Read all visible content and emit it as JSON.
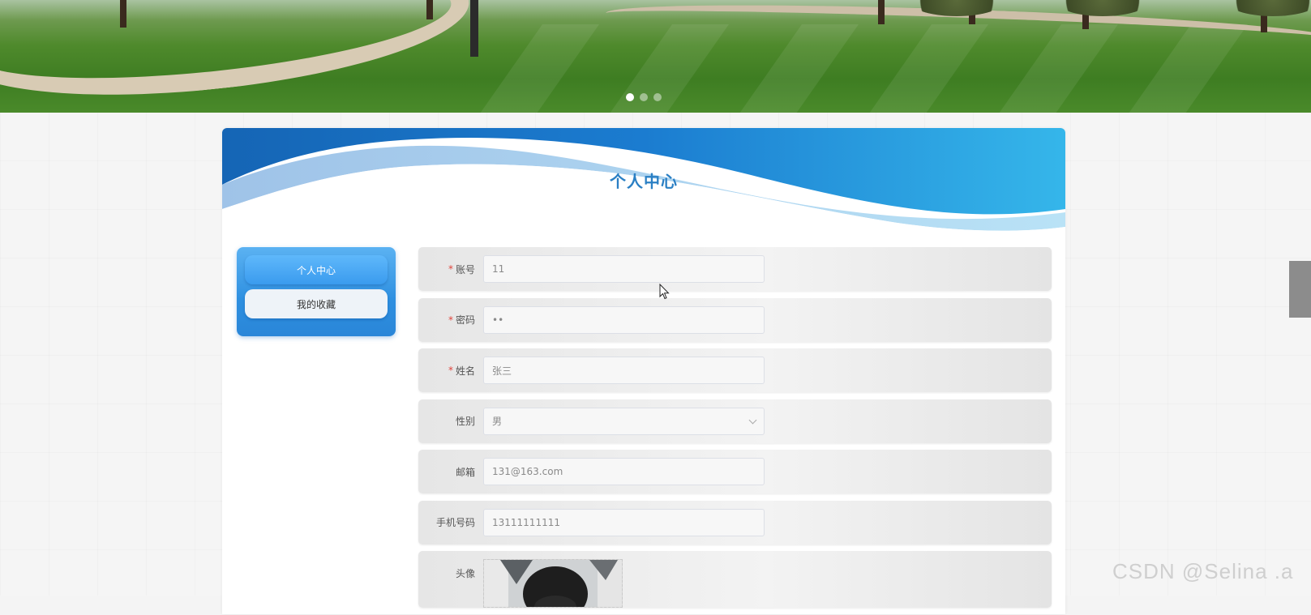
{
  "banner": {
    "slides": [
      {
        "active": true
      },
      {
        "active": false
      },
      {
        "active": false
      }
    ]
  },
  "page": {
    "title": "个人中心"
  },
  "side_menu": {
    "items": [
      {
        "label": "个人中心",
        "active": true
      },
      {
        "label": "我的收藏",
        "active": false
      }
    ]
  },
  "form": {
    "account": {
      "label": "账号",
      "required": true,
      "value": "11"
    },
    "password": {
      "label": "密码",
      "required": true,
      "value": "••"
    },
    "name": {
      "label": "姓名",
      "required": true,
      "value": "张三"
    },
    "gender": {
      "label": "性别",
      "required": false,
      "value": "男"
    },
    "email": {
      "label": "邮箱",
      "required": false,
      "value": "131@163.com"
    },
    "phone": {
      "label": "手机号码",
      "required": false,
      "value": "13111111111"
    },
    "avatar": {
      "label": "头像",
      "required": false
    }
  },
  "watermark": {
    "text": "CSDN @Selina .a"
  },
  "colors": {
    "title": "#2a7fc4",
    "menu_active": "#3a9bee",
    "required": "#e0443c"
  },
  "icons": {
    "select": "chevron-down-icon",
    "cursor": "mouse-pointer-icon"
  }
}
